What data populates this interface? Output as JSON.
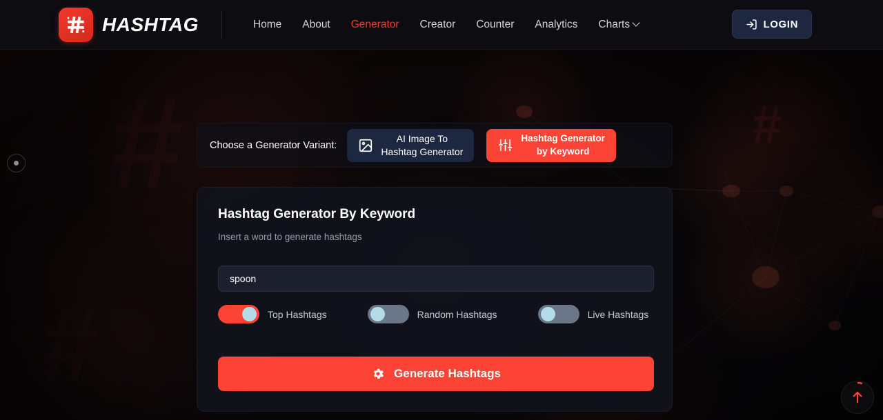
{
  "brand": {
    "name": "HASHTAG",
    "logo_icon": "hashtag-logo-icon",
    "accent_color": "#e8342a"
  },
  "nav": {
    "items": [
      {
        "label": "Home",
        "active": false,
        "has_chevron": false
      },
      {
        "label": "About",
        "active": false,
        "has_chevron": false
      },
      {
        "label": "Generator",
        "active": true,
        "has_chevron": false
      },
      {
        "label": "Creator",
        "active": false,
        "has_chevron": false
      },
      {
        "label": "Counter",
        "active": false,
        "has_chevron": false
      },
      {
        "label": "Analytics",
        "active": false,
        "has_chevron": false
      },
      {
        "label": "Charts",
        "active": false,
        "has_chevron": true
      }
    ]
  },
  "login": {
    "label": "LOGIN",
    "icon": "sign-in-icon"
  },
  "carousel": {
    "dot_icon": "carousel-dot-icon"
  },
  "variant_selector": {
    "label": "Choose a Generator Variant:",
    "options": [
      {
        "label": "AI Image To\nHashtag Generator",
        "icon": "image-icon",
        "active": false
      },
      {
        "label": "Hashtag Generator\nby Keyword",
        "icon": "sliders-icon",
        "active": true
      }
    ]
  },
  "generator_card": {
    "title": "Hashtag Generator By Keyword",
    "subtitle": "Insert a word to generate hashtags",
    "keyword_input": {
      "value": "spoon",
      "placeholder": "Insert a word to generate hashtags"
    },
    "toggles": [
      {
        "label": "Top Hashtags",
        "on": true
      },
      {
        "label": "Random Hashtags",
        "on": false
      },
      {
        "label": "Live Hashtags",
        "on": false
      }
    ],
    "generate_button": {
      "label": "Generate Hashtags",
      "icon": "gear-icon",
      "color": "#fb4436"
    }
  },
  "scroll_top": {
    "icon": "arrow-up-icon",
    "progress_percent": 4
  }
}
